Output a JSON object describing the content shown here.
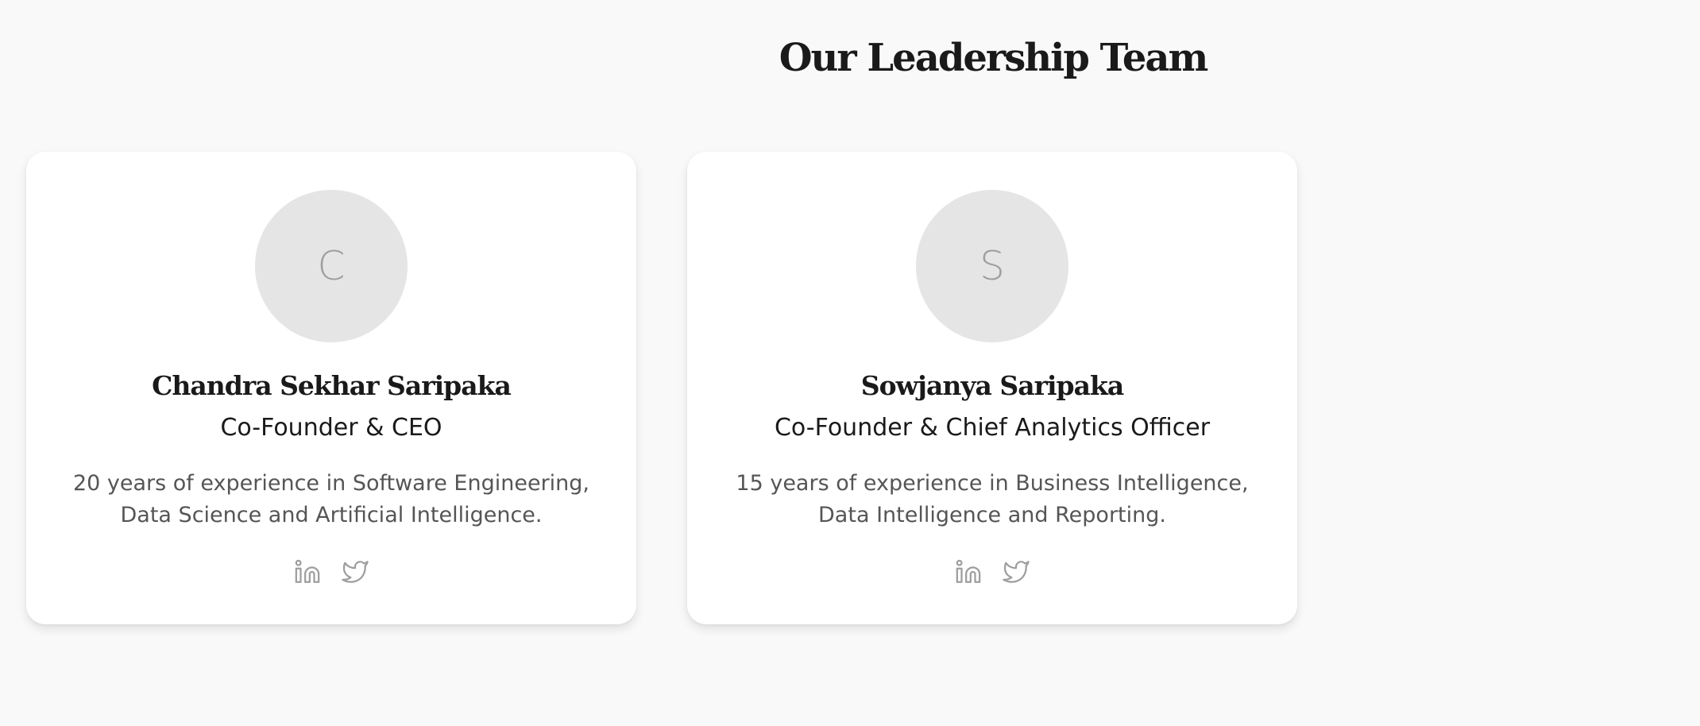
{
  "section": {
    "title": "Our Leadership Team"
  },
  "team": [
    {
      "initial": "C",
      "name": "Chandra Sekhar Saripaka",
      "role": "Co-Founder & CEO",
      "bio": "20 years of experience in Software Engineering, Data Science and Artificial Intelligence.",
      "socials": [
        "linkedin-icon",
        "twitter-icon"
      ]
    },
    {
      "initial": "S",
      "name": "Sowjanya Saripaka",
      "role": "Co-Founder & Chief Analytics Officer",
      "bio": "15 years of experience in Business Intelligence, Data Intelligence and Reporting.",
      "socials": [
        "linkedin-icon",
        "twitter-icon"
      ]
    }
  ],
  "colors": {
    "background": "#f9f9f9",
    "card": "#ffffff",
    "avatar": "#e5e5e5",
    "icon": "#9e9e9e",
    "heading": "#1a1a1a",
    "bio_text": "#555555"
  }
}
